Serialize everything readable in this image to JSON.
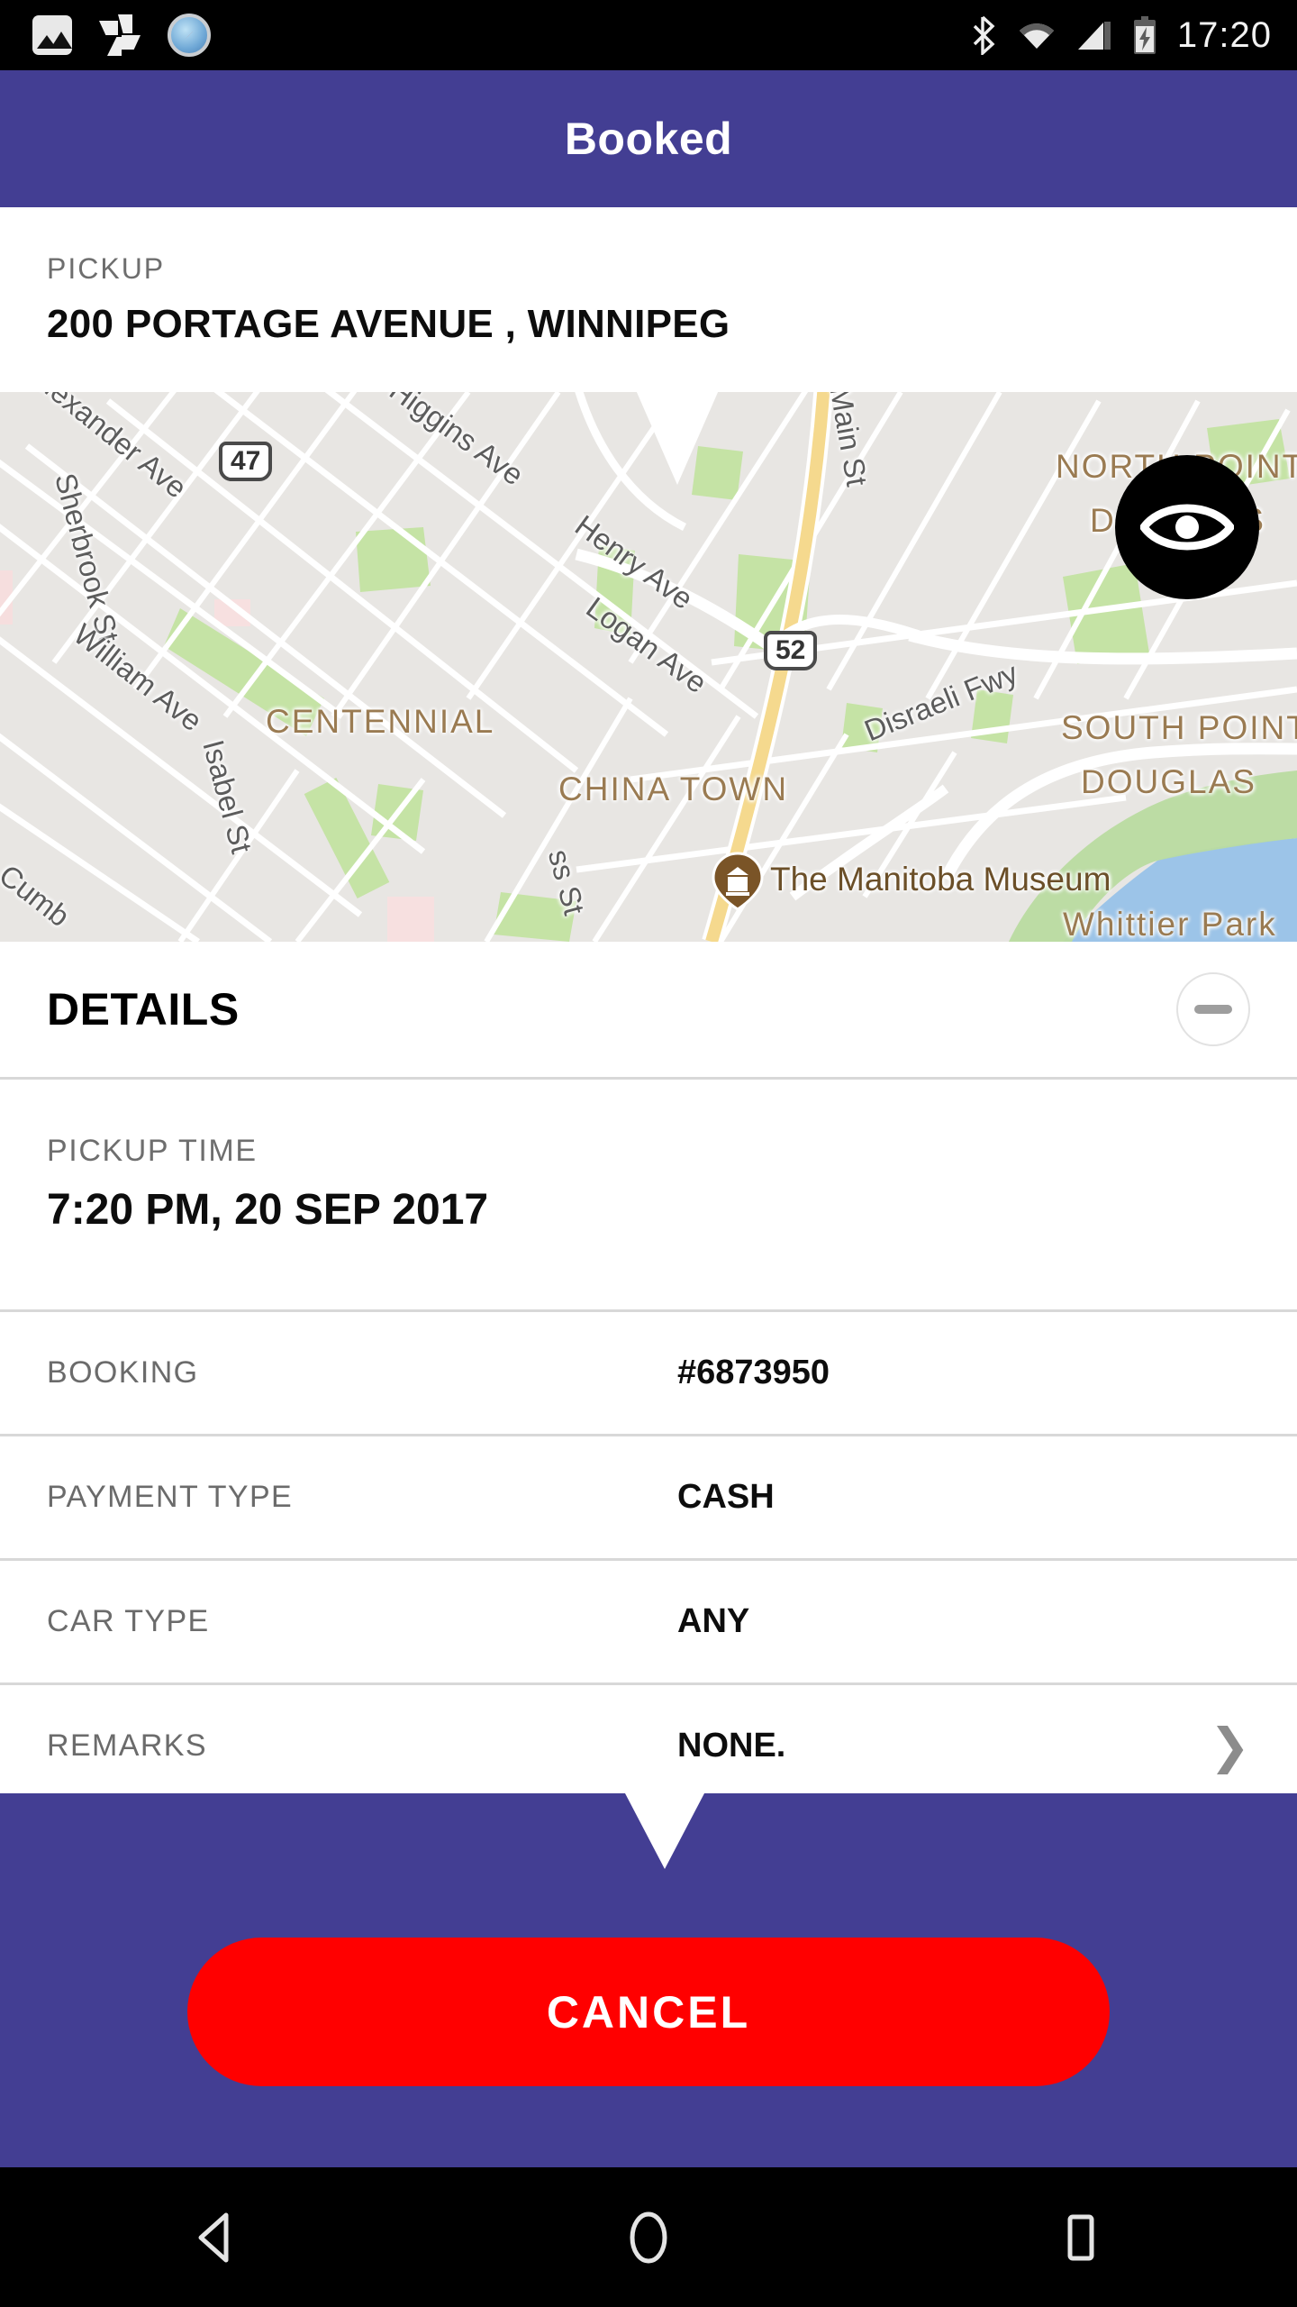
{
  "status_bar": {
    "time": "17:20",
    "left_icons": [
      "gallery-icon",
      "photos-icon",
      "compass-icon"
    ],
    "right_icons": [
      "bluetooth-icon",
      "wifi-icon",
      "signal-icon",
      "battery-charging-icon"
    ]
  },
  "app_bar": {
    "title": "Booked",
    "color": "#433E93"
  },
  "pickup": {
    "label": "PICKUP",
    "address": "200 PORTAGE AVENUE , WINNIPEG"
  },
  "map": {
    "streets": [
      "Alexander Ave",
      "Sherbrook St",
      "William Ave",
      "Isabel St",
      "Cumb",
      "Higgins Ave",
      "Henry Ave",
      "Logan Ave",
      "Main St",
      "Disraeli Fwy",
      "ss St"
    ],
    "shields": [
      "47",
      "52"
    ],
    "areas": [
      "CENTENNIAL",
      "CHINA TOWN",
      "NORTH POINT",
      "DOUGLAS",
      "SOUTH POINT",
      "DOUGLAS",
      "Whittier Park"
    ],
    "poi": "The Manitoba Museum",
    "view_button": "eye-icon"
  },
  "details": {
    "title": "DETAILS",
    "collapse_icon": "minus-circle-icon",
    "pickup_time": {
      "label": "PICKUP TIME",
      "value": "7:20 PM, 20 SEP 2017"
    },
    "rows": [
      {
        "label": "BOOKING",
        "value": "#6873950",
        "chevron": false
      },
      {
        "label": "PAYMENT TYPE",
        "value": "CASH",
        "chevron": false
      },
      {
        "label": "CAR TYPE",
        "value": "ANY",
        "chevron": false
      },
      {
        "label": "REMARKS",
        "value": "NONE.",
        "chevron": true
      }
    ]
  },
  "footer": {
    "cancel_label": "CANCEL",
    "cancel_color": "#FF0000"
  },
  "nav_bar": {
    "items": [
      "back-icon",
      "home-icon",
      "recents-icon"
    ]
  }
}
